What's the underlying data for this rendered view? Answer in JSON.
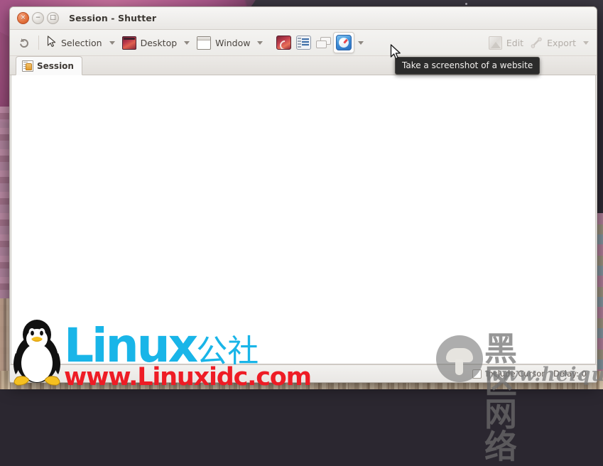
{
  "window": {
    "title": "Session - Shutter",
    "controls": {
      "close": "×",
      "minimize": "−",
      "maximize": "□"
    }
  },
  "toolbar": {
    "undo_icon": "undo-icon",
    "selection_label": "Selection",
    "desktop_label": "Desktop",
    "window_label": "Window",
    "web_icon": "web-screenshot-icon",
    "menu_icon": "menu-screenshot-icon",
    "tooltip_icon": "tooltip-screenshot-icon",
    "website_icon": "website-screenshot-icon",
    "edit_label": "Edit",
    "export_label": "Export"
  },
  "tabs": [
    {
      "label": "Session",
      "icon": "session-icon",
      "active": true
    }
  ],
  "tooltip": {
    "text": "Take a screenshot of a website"
  },
  "statusbar": {
    "include_cursor_label": "Include Cursor",
    "include_cursor_checked": false,
    "delay_label": "Delay: 0"
  },
  "watermarks": {
    "linuxidc": {
      "title": "Linux",
      "title_cn": "公社",
      "url": "www.Linuxidc.com",
      "title_color": "#19b5e8",
      "url_color": "#ee1c25"
    },
    "heiqu": {
      "title_cn": "黑区网络",
      "url": "www.heiqu.com"
    }
  }
}
